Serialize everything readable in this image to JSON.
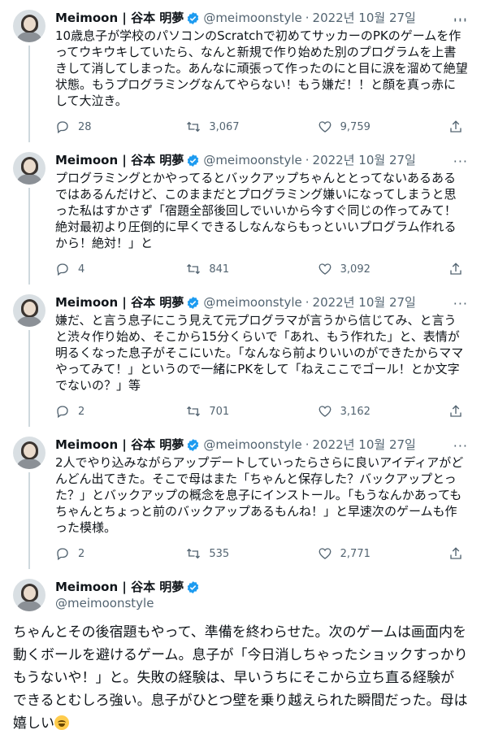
{
  "author": {
    "display_name": "Meimoon | 谷本 明夢",
    "handle": "@meimoonstyle",
    "date": "2022년 10월 27일",
    "separator": "·"
  },
  "tweets": [
    {
      "text": "10歳息子が学校のパソコンのScratchで初めてサッカーのPKのゲームを作ってウキウキしていたら、なんと新規で作り始めた別のプログラムを上書きして消してしまった。あんなに頑張って作ったのにと目に涙を溜めて絶望状態。もうプログラミングなんてやらない！もう嫌だ！！と顔を真っ赤にして大泣き。",
      "replies": "28",
      "retweets": "3,067",
      "likes": "9,759"
    },
    {
      "text": "プログラミングとかやってるとバックアップちゃんととってないあるあるではあるんだけど、このままだとプログラミング嫌いになってしまうと思った私はすかさず「宿題全部後回しでいいから今すぐ同じの作ってみて！絶対最初より圧倒的に早くできるしなんならもっといいプログラム作れるから！絶対！」と",
      "replies": "4",
      "retweets": "841",
      "likes": "3,092"
    },
    {
      "text": "嫌だ、と言う息子にこう見えて元プログラマが言うから信じてみ、と言うと渋々作り始め、そこから15分くらいで「あれ、もう作れた」と、表情が明るくなった息子がそこにいた。「なんなら前よりいいのができたからママやってみて！」というので一緒にPKをして「ねえここでゴール！とか文字でないの？」等",
      "replies": "2",
      "retweets": "701",
      "likes": "3,162"
    },
    {
      "text": "2人でやり込みながらアップデートしていったらさらに良いアイディアがどんどん出てきた。そこで母はまた「ちゃんと保存した？バックアップとった？」とバックアップの概念を息子にインストール。「もうなんかあってもちゃんとちょっと前のバックアップあるもんね！」と早速次のゲームも作った模様。",
      "replies": "2",
      "retweets": "535",
      "likes": "2,771"
    }
  ],
  "main_tweet": {
    "text": "ちゃんとその後宿題もやって、準備を終わらせた。次のゲームは画面内を動くボールを避けるゲーム。息子が「今日消しちゃったショックすっかりもうないや！」と。失敗の経験は、早いうちにそこから立ち直る経験ができるとむしろ強い。息子がひとつ壁を乗り越えられた瞬間だった。母は嬉しい",
    "emoji": "grinning-squinting-face-emoji"
  },
  "more_label": "···",
  "colors": {
    "verified": "#1d9bf0",
    "secondary_text": "#536471"
  }
}
